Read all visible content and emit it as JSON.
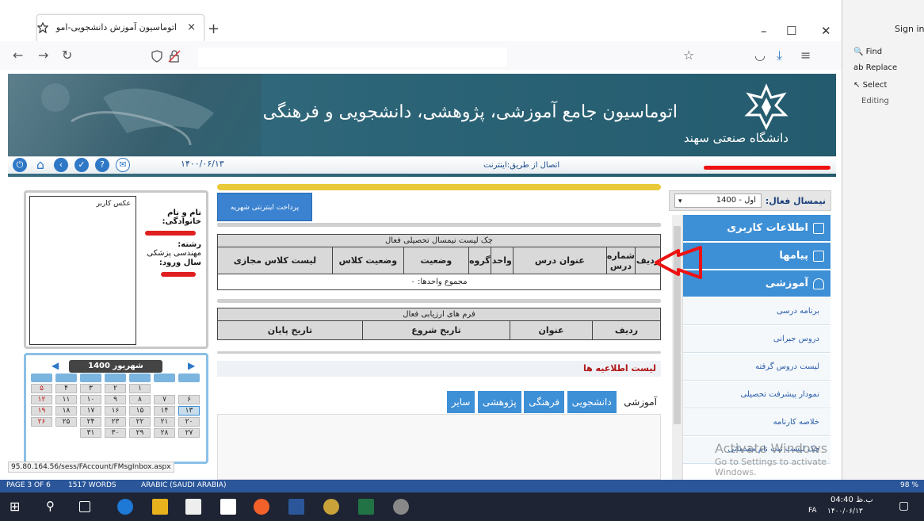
{
  "browser": {
    "tab_title": "اتوماسیون آموزش دانشجویی-امو",
    "tab_close": "×",
    "new_tab": "+",
    "minimize": "–",
    "maximize": "☐",
    "close": "✕",
    "status_url": "95.80.164.56/sess/FAccount/FMsgInbox.aspx"
  },
  "header": {
    "title": "اتوماسیون جامع آموزشی، پژوهشی، دانشجویی و فرهنگی",
    "university": "دانشگاه صنعتی سهند",
    "date": "۱۴۰۰/۰۶/۱۳",
    "connection": "اتصال از طریق:اینترنت"
  },
  "semester": {
    "label": "نیمسال فعال:",
    "value": "اول - 1400"
  },
  "menu": {
    "user_info": "اطلاعات کاربری",
    "messages": "پیامها",
    "education": "آموزشی",
    "sub_items": [
      "برنامه درسی",
      "دروس جبرانی",
      "لیست دروس گرفته",
      "نمودار پیشرفت تحصیلی",
      "خلاصه کارنامه",
      "چک لیست ثبت نام مقدماتی"
    ]
  },
  "payment_button": "پرداخت اینترنتی شهریه",
  "courses_table": {
    "title": "چک لیست نیمسال تحصیلی فعال",
    "headers": [
      "ردیف",
      "شماره درس",
      "عنوان درس",
      "واحد",
      "گروه",
      "وضعیت",
      "وضعیت کلاس",
      "لیست کلاس مجازی"
    ],
    "total": "مجموع واحدها: ۰"
  },
  "eval_table": {
    "title": "فرم های ارزیابی فعال",
    "headers": [
      "ردیف",
      "عنوان",
      "تاریخ شروع",
      "تاریخ پایان"
    ]
  },
  "news": {
    "heading": "لیست اطلاعیه ها",
    "tabs": [
      "آموزشی",
      "دانشجویی",
      "فرهنگی",
      "پژوهشی",
      "سایر"
    ]
  },
  "profile": {
    "photo_label": "عکس کاربر",
    "name_label": "نام و نام خانوادگی:",
    "major_label": "رشته:",
    "major_value": "مهندسی پزشکی",
    "entry_label": "سال ورود:"
  },
  "calendar": {
    "title": "شهریور 1400",
    "rows": [
      [
        "",
        "",
        "۱",
        "۲",
        "۳",
        "۴",
        "۵"
      ],
      [
        "۶",
        "۷",
        "۸",
        "۹",
        "۱۰",
        "۱۱",
        "۱۲"
      ],
      [
        "۱۳",
        "۱۴",
        "۱۵",
        "۱۶",
        "۱۷",
        "۱۸",
        "۱۹"
      ],
      [
        "۲۰",
        "۲۱",
        "۲۲",
        "۲۳",
        "۲۴",
        "۲۵",
        "۲۶"
      ],
      [
        "۲۷",
        "۲۸",
        "۲۹",
        "۳۰",
        "۳۱",
        "",
        ""
      ]
    ]
  },
  "word_pane": {
    "find": "Find",
    "replace": "Replace",
    "select": "Select",
    "editing": "Editing",
    "signin": "Sign in"
  },
  "word_status": {
    "page": "PAGE 3 OF 6",
    "words": "1517 WORDS",
    "language": "ARABIC (SAUDI ARABIA)",
    "zoom": "98 %"
  },
  "watermark": {
    "line1": "Activate Windows",
    "line2": "Go to Settings to activate Windows."
  },
  "taskbar": {
    "time": "04:40 ب.ظ",
    "date": "۱۴۰۰/۰۶/۱۳",
    "lang": "FA"
  }
}
